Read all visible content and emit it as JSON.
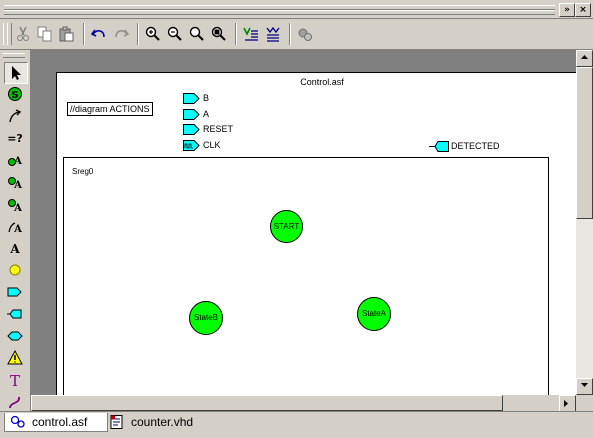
{
  "window": {
    "controls": [
      "»",
      "×"
    ]
  },
  "toolbar": {
    "buttons": [
      "cut",
      "copy",
      "paste",
      "undo",
      "redo",
      "zoom-in",
      "zoom-out",
      "zoom-fit",
      "zoom-window",
      "check-diagram",
      "generate-hdl",
      "simulate"
    ]
  },
  "left_toolbar": {
    "tools": [
      "select",
      "state",
      "transition",
      "condition",
      "state-action",
      "entry-action",
      "exit-action",
      "transition-action",
      "action",
      "junction",
      "input-port",
      "output-port",
      "bidir-port",
      "warning",
      "text",
      "wire"
    ],
    "glyphs": {
      "condition": "=?",
      "action": "A",
      "text": "T"
    }
  },
  "diagram": {
    "title": "Control.asf",
    "declaration": "//diagram ACTIONS",
    "inputs": [
      "B",
      "A",
      "RESET",
      "CLK"
    ],
    "outputs": [
      "DETECTED"
    ],
    "machine_name": "Sreg0",
    "states": [
      "START",
      "StateB",
      "StateA"
    ],
    "colors": {
      "state_fill": "#00ff00",
      "port_fill": "#00ffff"
    }
  },
  "tabs": [
    {
      "label": "control.asf",
      "active": true
    },
    {
      "label": "counter.vhd",
      "active": false
    }
  ]
}
